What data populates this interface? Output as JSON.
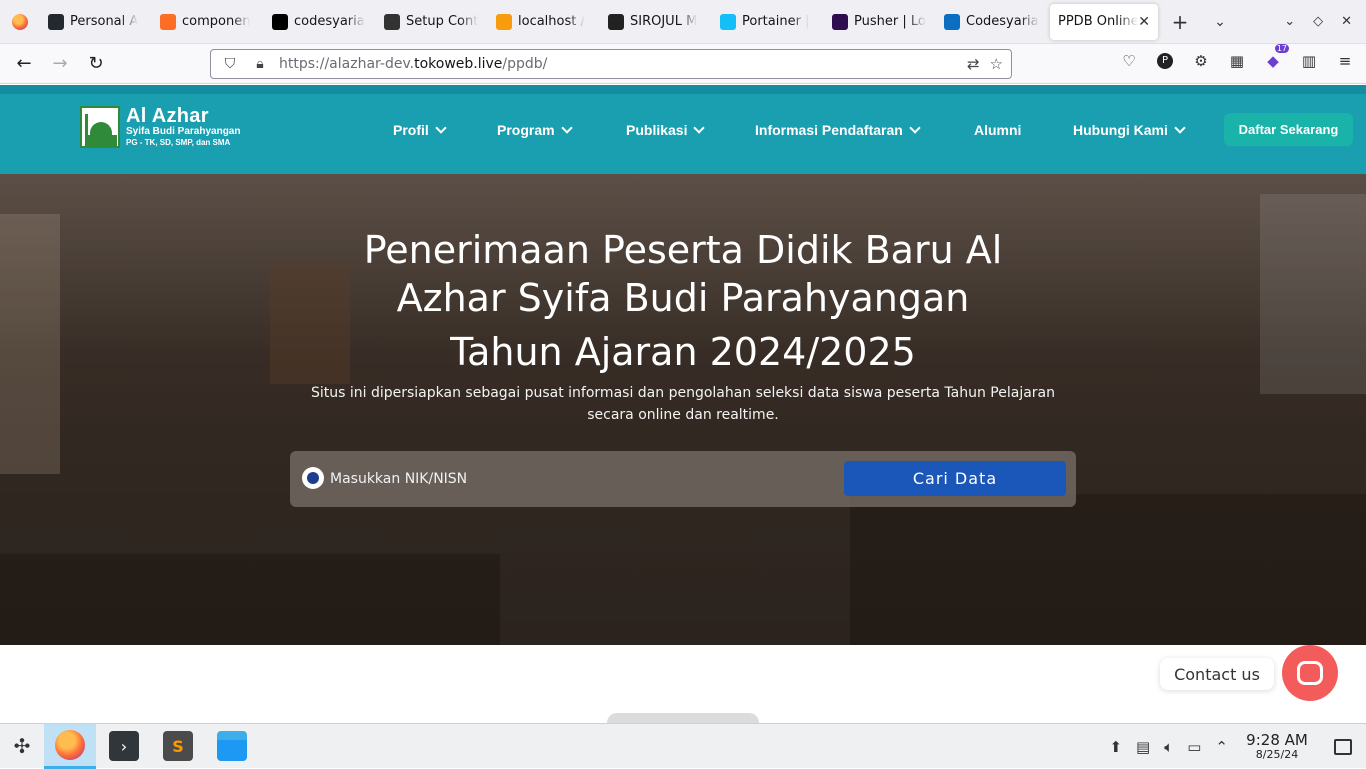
{
  "browser": {
    "tabs": [
      {
        "label": "Personal A",
        "favicon": "github-icon",
        "color": "#24292f"
      },
      {
        "label": "componen",
        "favicon": "gitlab-icon",
        "color": "#fc6d26"
      },
      {
        "label": "codesyaria",
        "favicon": "vercel-icon",
        "color": "#000000"
      },
      {
        "label": "Setup Cont",
        "favicon": "openai-icon",
        "color": "#333333"
      },
      {
        "label": "localhost /",
        "favicon": "phpmyadmin-icon",
        "color": "#f89c0e"
      },
      {
        "label": "SIROJUL M",
        "favicon": "app-icon",
        "color": "#222222"
      },
      {
        "label": "Portainer |",
        "favicon": "portainer-icon",
        "color": "#13bef9"
      },
      {
        "label": "Pusher | Lo",
        "favicon": "pusher-icon",
        "color": "#300d4f"
      },
      {
        "label": "Codesyaria",
        "favicon": "vscode-icon",
        "color": "#0a6ec2"
      }
    ],
    "active_tab": {
      "label": "PPDB Online"
    },
    "url": {
      "prefix": "https://alazhar-dev.",
      "domain": "tokoweb.live",
      "path": "/ppdb/"
    },
    "extension_badge": "17"
  },
  "site": {
    "logo": {
      "title": "Al Azhar",
      "subtitle": "Syifa Budi Parahyangan",
      "tagline": "PG - TK, SD, SMP, dan SMA"
    },
    "nav": [
      {
        "label": "Profil",
        "dropdown": true
      },
      {
        "label": "Program",
        "dropdown": true
      },
      {
        "label": "Publikasi",
        "dropdown": true
      },
      {
        "label": "Informasi Pendaftaran",
        "dropdown": true
      },
      {
        "label": "Alumni",
        "dropdown": false
      },
      {
        "label": "Hubungi Kami",
        "dropdown": true
      }
    ],
    "cta": "Daftar Sekarang",
    "colors": {
      "header": "#1a9fb1",
      "cta": "#19b3a9",
      "button": "#1b57b8",
      "contact": "#f45c5c"
    }
  },
  "hero": {
    "title_line1": "Penerimaan Peserta Didik Baru Al",
    "title_line2": "Azhar Syifa Budi Parahyangan",
    "title_line3": "Tahun Ajaran 2024/2025",
    "description": "Situs ini dipersiapkan sebagai pusat informasi dan pengolahan seleksi data siswa peserta Tahun Pelajaran secara online dan realtime.",
    "search_placeholder": "Masukkan NIK/NISN",
    "search_button": "Cari Data"
  },
  "contact": {
    "label": "Contact us"
  },
  "taskbar": {
    "time": "9:28 AM",
    "date": "8/25/24"
  }
}
